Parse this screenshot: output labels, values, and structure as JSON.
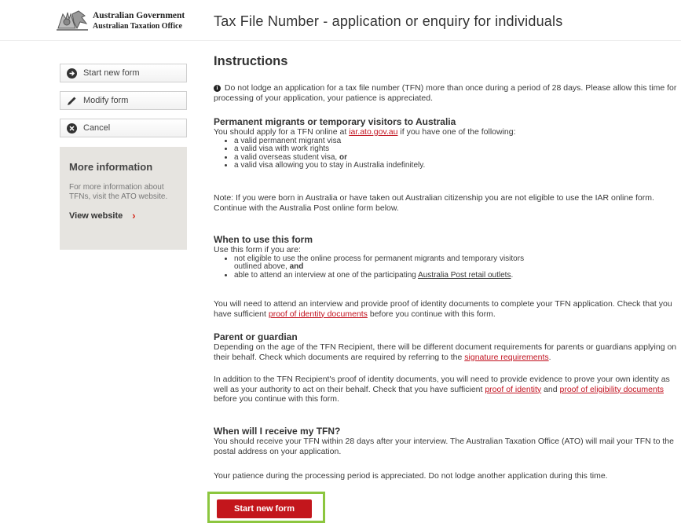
{
  "header": {
    "logo_line1": "Australian Government",
    "logo_line2": "Australian Taxation Office",
    "title": "Tax File Number - application or enquiry for individuals"
  },
  "sidebar": {
    "buttons": [
      {
        "label": "Start new form",
        "icon": "arrow-right-circle-icon"
      },
      {
        "label": "Modify form",
        "icon": "pencil-icon"
      },
      {
        "label": "Cancel",
        "icon": "close-circle-icon"
      }
    ],
    "more_info": {
      "title": "More information",
      "text": "For more information about TFNs, visit the ATO website.",
      "link_label": "View website",
      "link_chevron": "›"
    }
  },
  "main": {
    "instructions": {
      "heading": "Instructions",
      "text": "Do not lodge an application for a tax file number (TFN) more than once during a period of 28 days. Please allow this time for processing of your application, your patience is appreciated."
    },
    "migrants": {
      "heading": "Permanent migrants or temporary visitors to Australia",
      "intro_before": "You should apply for a TFN online at ",
      "link": "iar.ato.gov.au",
      "intro_after": " if you have one of the following:",
      "items": [
        "a valid permanent migrant visa",
        "a valid visa with work rights",
        "a valid overseas student visa,",
        "a valid visa allowing you to stay in Australia indefinitely."
      ],
      "or_word": "or",
      "note": "Note: If you were born in Australia or have taken out Australian citizenship you are not eligible to use the IAR online form. Continue with the Australia Post online form below."
    },
    "when_to_use": {
      "heading": "When to use this form",
      "intro": "Use this form if you are:",
      "item1": "not eligible to use the online process for permanent migrants and temporary visitors outlined above,",
      "and_word": "and",
      "item2_before": "able to attend an interview at one of the participating ",
      "item2_link": "Australia Post retail outlets",
      "item2_after": ".",
      "para_before": "You will need to attend an interview and provide proof of identity documents to complete your TFN application. Check that you have sufficient ",
      "para_link": "proof of identity documents",
      "para_after": " before you continue with this form."
    },
    "parent": {
      "heading": "Parent or guardian",
      "p1_before": "Depending on the age of the TFN Recipient, there will be different document requirements for parents or guardians applying on their behalf. Check which documents are required by referring to the ",
      "p1_link": "signature requirements",
      "p1_after": ".",
      "p2_before": "In addition to the TFN Recipient's proof of identity documents, you will need to provide evidence to prove your own identity as well as your authority to act on their behalf. Check that you have sufficient ",
      "p2_link1": "proof of identity",
      "p2_mid": " and ",
      "p2_link2": "proof of eligibility documents",
      "p2_after": " before you continue with this form."
    },
    "receive": {
      "heading": "When will I receive my TFN?",
      "p1": "You should receive your TFN within 28 days after your interview. The Australian Taxation Office (ATO) will mail your TFN to the postal address on your application.",
      "p2": "Your patience during the processing period is appreciated. Do not lodge another application during this time."
    },
    "start_button": "Start new form"
  },
  "colors": {
    "accent": "#c3161c",
    "highlight": "#8cc63f",
    "panel": "#e6e4e0"
  }
}
